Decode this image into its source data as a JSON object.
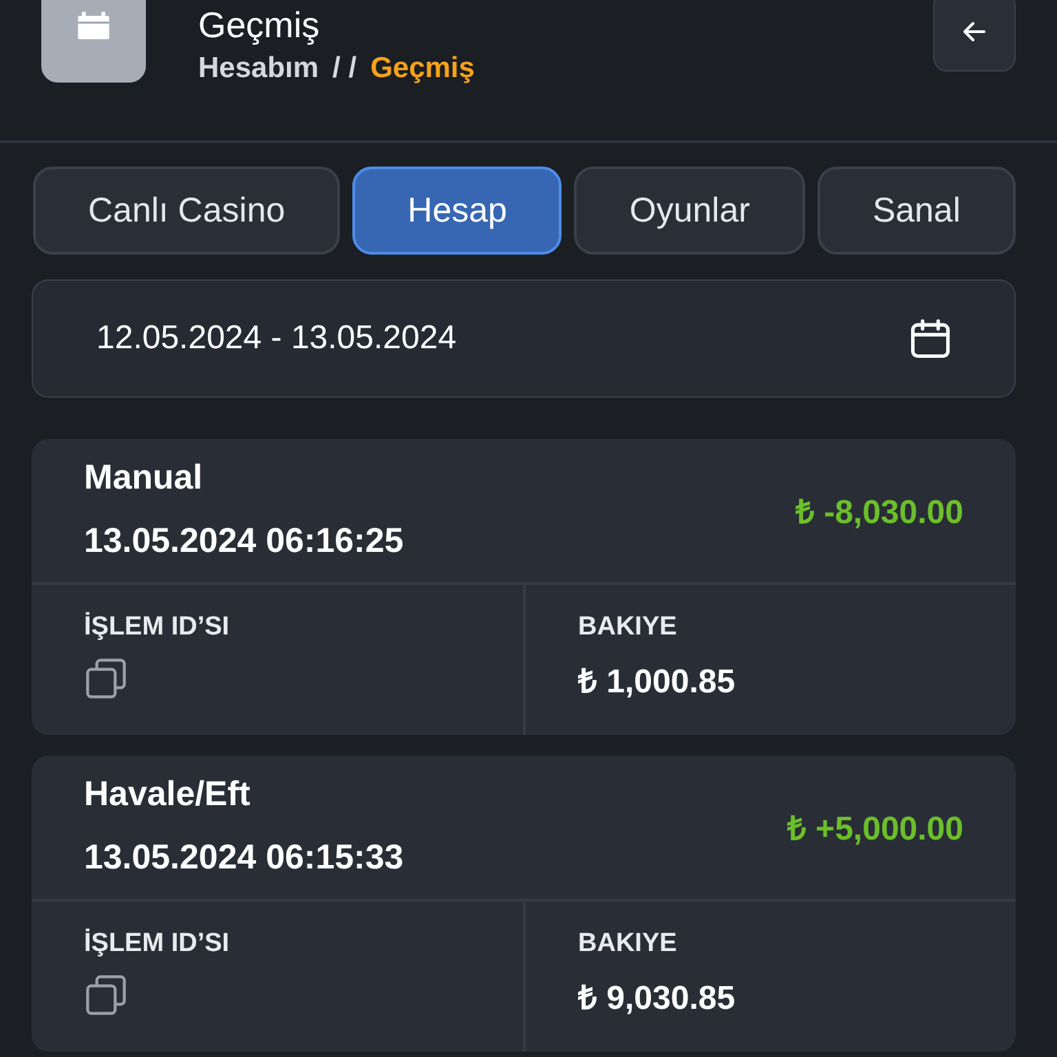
{
  "header": {
    "title": "Geçmiş",
    "breadcrumb": [
      {
        "label": "Hesabım",
        "selected": false
      },
      {
        "label": "Geçmiş",
        "selected": true
      }
    ],
    "separator": "/ /"
  },
  "tabs": [
    {
      "label": "Canlı Casino",
      "selected": false
    },
    {
      "label": "Hesap",
      "selected": true
    },
    {
      "label": "Oyunlar",
      "selected": false
    },
    {
      "label": "Sanal",
      "selected": false
    }
  ],
  "date_range": {
    "value": "12.05.2024 - 13.05.2024"
  },
  "transactions": [
    {
      "type": "Manual",
      "datetime": "13.05.2024 06:16:25",
      "amount": "₺ -8,030.00",
      "id_label": "İŞLEM ID’SI",
      "balance_label": "BAKIYE",
      "balance": "₺ 1,000.85"
    },
    {
      "type": "Havale/Eft",
      "datetime": "13.05.2024 06:15:33",
      "amount": "₺ +5,000.00",
      "id_label": "İŞLEM ID’SI",
      "balance_label": "BAKIYE",
      "balance": "₺ 9,030.85"
    }
  ]
}
